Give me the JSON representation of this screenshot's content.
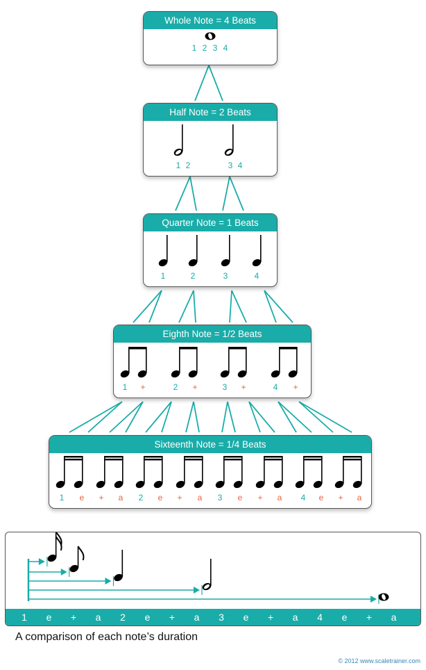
{
  "colors": {
    "accent": "#1aaca8",
    "count_teal": "#1aaca8",
    "count_orange": "#e8643c",
    "note": "#000000"
  },
  "levels": [
    {
      "title": "Whole Note = 4 Beats",
      "note_type": "whole-note",
      "counts": [
        {
          "text": "1",
          "color": "teal"
        },
        {
          "text": "2",
          "color": "teal"
        },
        {
          "text": "3",
          "color": "teal"
        },
        {
          "text": "4",
          "color": "teal"
        }
      ]
    },
    {
      "title": "Half Note = 2 Beats",
      "note_type": "half-note",
      "counts": [
        {
          "text": "1",
          "color": "teal"
        },
        {
          "text": "2",
          "color": "teal"
        },
        {
          "text": "3",
          "color": "teal"
        },
        {
          "text": "4",
          "color": "teal"
        }
      ]
    },
    {
      "title": "Quarter Note = 1 Beats",
      "note_type": "quarter-note",
      "counts": [
        {
          "text": "1",
          "color": "teal"
        },
        {
          "text": "2",
          "color": "teal"
        },
        {
          "text": "3",
          "color": "teal"
        },
        {
          "text": "4",
          "color": "teal"
        }
      ]
    },
    {
      "title": "Eighth Note = 1/2 Beats",
      "note_type": "eighth-note-pair",
      "counts": [
        {
          "text": "1",
          "color": "teal"
        },
        {
          "text": "+",
          "color": "orange"
        },
        {
          "text": "2",
          "color": "teal"
        },
        {
          "text": "+",
          "color": "orange"
        },
        {
          "text": "3",
          "color": "teal"
        },
        {
          "text": "+",
          "color": "orange"
        },
        {
          "text": "4",
          "color": "teal"
        },
        {
          "text": "+",
          "color": "orange"
        }
      ]
    },
    {
      "title": "Sixteenth Note = 1/4 Beats",
      "note_type": "sixteenth-note-pair",
      "counts": [
        {
          "text": "1",
          "color": "teal"
        },
        {
          "text": "e",
          "color": "orange"
        },
        {
          "text": "+",
          "color": "orange"
        },
        {
          "text": "a",
          "color": "orange"
        },
        {
          "text": "2",
          "color": "teal"
        },
        {
          "text": "e",
          "color": "orange"
        },
        {
          "text": "+",
          "color": "orange"
        },
        {
          "text": "a",
          "color": "orange"
        },
        {
          "text": "3",
          "color": "teal"
        },
        {
          "text": "e",
          "color": "orange"
        },
        {
          "text": "+",
          "color": "orange"
        },
        {
          "text": "a",
          "color": "orange"
        },
        {
          "text": "4",
          "color": "teal"
        },
        {
          "text": "e",
          "color": "orange"
        },
        {
          "text": "+",
          "color": "orange"
        },
        {
          "text": "a",
          "color": "orange"
        }
      ]
    }
  ],
  "comparison": {
    "notes": [
      {
        "name": "sixteenth-note",
        "beats": 0.25
      },
      {
        "name": "eighth-note",
        "beats": 0.5
      },
      {
        "name": "quarter-note",
        "beats": 1
      },
      {
        "name": "half-note",
        "beats": 2
      },
      {
        "name": "whole-note",
        "beats": 4
      }
    ],
    "count_bar": [
      "1",
      "e",
      "+",
      "a",
      "2",
      "e",
      "+",
      "a",
      "3",
      "e",
      "+",
      "a",
      "4",
      "e",
      "+",
      "a"
    ]
  },
  "caption": "A comparison of each note’s duration",
  "copyright": "© 2012 www.scaletrainer.com"
}
